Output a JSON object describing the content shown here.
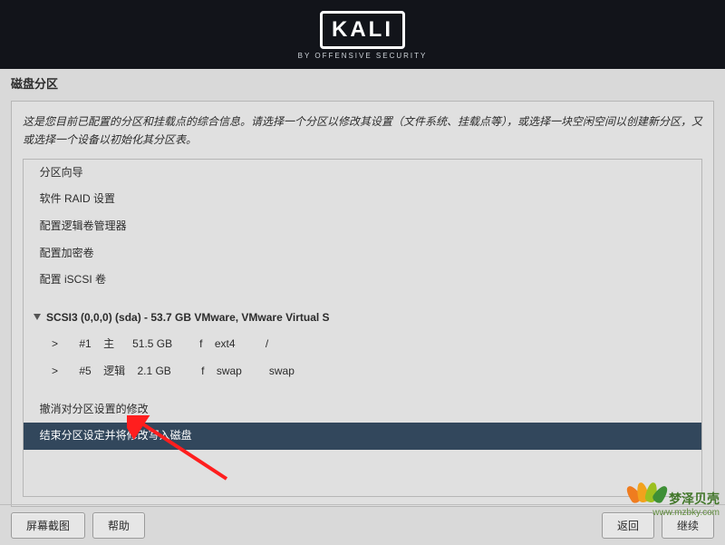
{
  "logo": {
    "text": "KALI",
    "subtitle": "BY OFFENSIVE SECURITY"
  },
  "page_title": "磁盘分区",
  "description": "这是您目前已配置的分区和挂载点的综合信息。请选择一个分区以修改其设置（文件系统、挂载点等），或选择一块空闲空间以创建新分区，又或选择一个设备以初始化其分区表。",
  "menu": {
    "guided": "分区向导",
    "raid": "软件 RAID 设置",
    "lvm": "配置逻辑卷管理器",
    "crypt": "配置加密卷",
    "iscsi": "配置 iSCSI 卷"
  },
  "disk_line": "SCSI3 (0,0,0) (sda) - 53.7 GB VMware, VMware Virtual S",
  "partitions": [
    {
      "indicator": ">",
      "num": "#1",
      "type": "主",
      "size": "51.5 GB",
      "flag": "f",
      "fs": "ext4",
      "mount": "/"
    },
    {
      "indicator": ">",
      "num": "#5",
      "type": "逻辑",
      "size": "2.1 GB",
      "flag": "f",
      "fs": "swap",
      "mount": "swap"
    }
  ],
  "undo": "撤消对分区设置的修改",
  "finish": "结束分区设定并将修改写入磁盘",
  "buttons": {
    "screenshot": "屏幕截图",
    "help": "帮助",
    "back": "返回",
    "continue": "继续"
  },
  "watermark": {
    "title": "梦泽贝壳",
    "url": "www.mzbky.com"
  }
}
